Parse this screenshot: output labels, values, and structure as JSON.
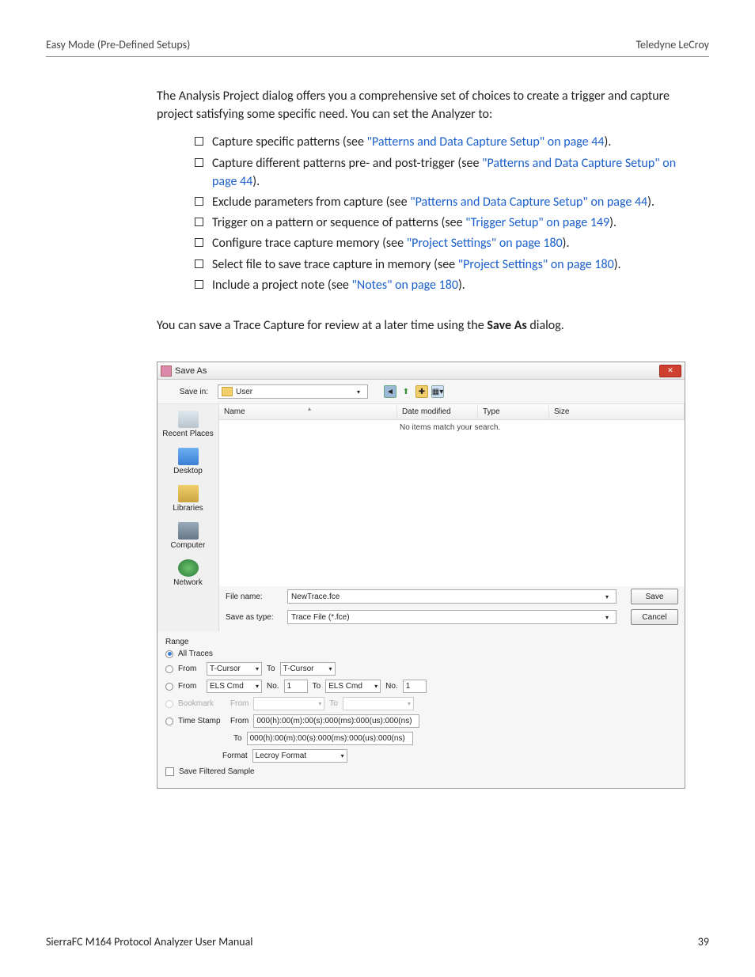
{
  "header": {
    "left": "Easy Mode (Pre-Defined Setups)",
    "right": "Teledyne LeCroy"
  },
  "intro": "The Analysis Project dialog offers you a comprehensive set of choices to create a trigger and capture project satisfying some specific need. You can set the Analyzer to:",
  "bullets": [
    {
      "pre": "Capture specific patterns (see ",
      "link": "\"Patterns and Data Capture Setup\" on page 44",
      "post": ")."
    },
    {
      "pre": "Capture different patterns pre- and post-trigger (see ",
      "link": "\"Patterns and Data Capture Setup\" on page 44",
      "post": ")."
    },
    {
      "pre": "Exclude parameters from capture (see ",
      "link": "\"Patterns and Data Capture Setup\" on page 44",
      "post": ")."
    },
    {
      "pre": "Trigger on a pattern or sequence of patterns (see ",
      "link": "\"Trigger Setup\" on page 149",
      "post": ")."
    },
    {
      "pre": "Configure trace capture memory (see ",
      "link": "\"Project Settings\" on page 180",
      "post": ")."
    },
    {
      "pre": "Select file to save trace capture in memory (see ",
      "link": "\"Project Settings\" on page 180",
      "post": ")."
    },
    {
      "pre": "Include a project note (see ",
      "link": "\"Notes\" on page 180",
      "post": ")."
    }
  ],
  "para2_a": "You can save a Trace Capture for review at a later time using the ",
  "para2_bold": "Save As",
  "para2_b": " dialog.",
  "dialog": {
    "title": "Save As",
    "save_in_label": "Save in:",
    "save_in_value": "User",
    "places": [
      "Recent Places",
      "Desktop",
      "Libraries",
      "Computer",
      "Network"
    ],
    "columns": {
      "name": "Name",
      "date": "Date modified",
      "type": "Type",
      "size": "Size"
    },
    "empty_msg": "No items match your search.",
    "file_name_label": "File name:",
    "file_name_value": "NewTrace.fce",
    "save_type_label": "Save as type:",
    "save_type_value": "Trace File (*.fce)",
    "save_btn": "Save",
    "cancel_btn": "Cancel",
    "range": {
      "title": "Range",
      "all": "All Traces",
      "from": "From",
      "to": "To",
      "tcursor": "T-Cursor",
      "elscmd": "ELS Cmd",
      "no": "No.",
      "no_val": "1",
      "bookmark": "Bookmark",
      "timestamp": "Time Stamp",
      "ts_val": "000(h):00(m):00(s):000(ms):000(us):000(ns)",
      "format": "Format",
      "format_val": "Lecroy Format",
      "filtered": "Save Filtered Sample"
    }
  },
  "footer": {
    "left": "SierraFC M164 Protocol Analyzer User Manual",
    "right": "39"
  }
}
